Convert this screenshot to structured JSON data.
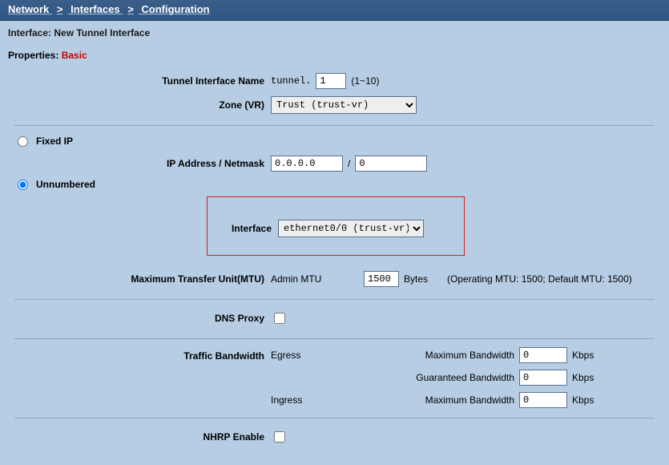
{
  "breadcrumb": {
    "a": "Network",
    "b": "Interfaces",
    "c": "Configuration"
  },
  "subheader": "Interface: New Tunnel Interface",
  "properties_label": "Properties:",
  "properties_mode": "Basic",
  "tunnel_name": {
    "label": "Tunnel Interface Name",
    "prefix": "tunnel.",
    "value": "1",
    "range": "(1~10)"
  },
  "zone": {
    "label": "Zone (VR)",
    "value": "Trust (trust-vr)"
  },
  "ip_mode": {
    "fixed_label": "Fixed IP",
    "unnumbered_label": "Unnumbered",
    "selected": "unnumbered"
  },
  "ip_fields": {
    "label": "IP Address / Netmask",
    "ip_value": "0.0.0.0",
    "slash": "/",
    "mask_value": "0"
  },
  "interface": {
    "label": "Interface",
    "value": "ethernet0/0 (trust-vr)"
  },
  "mtu": {
    "label": "Maximum Transfer Unit(MTU)",
    "admin_label": "Admin MTU",
    "value": "1500",
    "unit": "Bytes",
    "note": "(Operating MTU: 1500; Default MTU: 1500)"
  },
  "dns_proxy": {
    "label": "DNS Proxy"
  },
  "bandwidth": {
    "label": "Traffic Bandwidth",
    "egress": "Egress",
    "ingress": "Ingress",
    "max_label": "Maximum Bandwidth",
    "guar_label": "Guaranteed Bandwidth",
    "egress_max": "0",
    "egress_guar": "0",
    "ingress_max": "0",
    "unit": "Kbps"
  },
  "nhrp": {
    "label": "NHRP Enable"
  }
}
